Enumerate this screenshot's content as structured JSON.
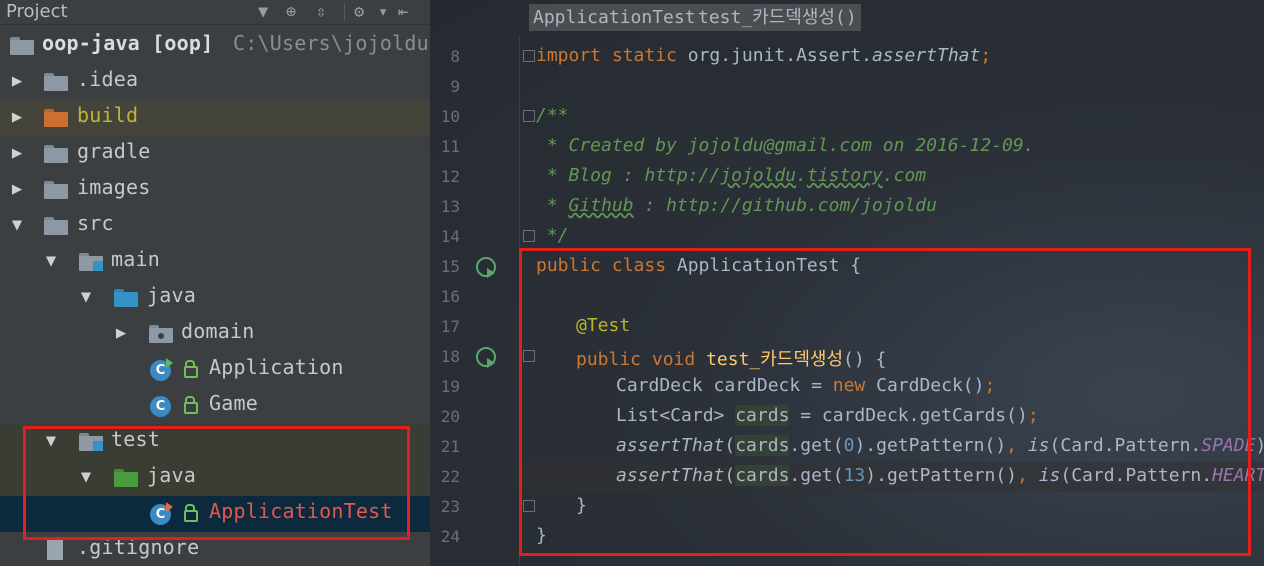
{
  "project_panel": {
    "title": "Project",
    "tree": [
      {
        "id": "root",
        "label": "oop-java [oop]",
        "path": "C:\\Users\\jojoldu\\"
      },
      {
        "id": "idea",
        "label": ".idea"
      },
      {
        "id": "build",
        "label": "build"
      },
      {
        "id": "gradle",
        "label": "gradle"
      },
      {
        "id": "images",
        "label": "images"
      },
      {
        "id": "src",
        "label": "src"
      },
      {
        "id": "main",
        "label": "main"
      },
      {
        "id": "main_java",
        "label": "java"
      },
      {
        "id": "domain",
        "label": "domain"
      },
      {
        "id": "application",
        "label": "Application"
      },
      {
        "id": "game",
        "label": "Game"
      },
      {
        "id": "test",
        "label": "test"
      },
      {
        "id": "test_java",
        "label": "java"
      },
      {
        "id": "application_test",
        "label": "ApplicationTest"
      },
      {
        "id": "gitignore",
        "label": ".gitignore"
      }
    ]
  },
  "editor": {
    "tabs": [
      "ApplicationTest",
      "test_카드덱생성()"
    ],
    "line_numbers": [
      "8",
      "9",
      "10",
      "11",
      "12",
      "13",
      "14",
      "15",
      "16",
      "17",
      "18",
      "19",
      "20",
      "21",
      "22",
      "23",
      "24"
    ],
    "code": {
      "l8_kw": "import static",
      "l8_rest": " org.junit.Assert.",
      "l8_it": "assertThat",
      "l8_semi": ";",
      "l10": "/**",
      "l11": " * Created by jojoldu@gmail.com on 2016-12-09.",
      "l12_a": " * Blog : http://",
      "l12_b": "jojoldu",
      "l12_c": ".",
      "l12_d": "tistory",
      "l12_e": ".com",
      "l13_a": " * ",
      "l13_b": "Github",
      "l13_c": " : http://github.com/jojoldu",
      "l14": " */",
      "l15_kw": "public class",
      "l15_rest": " ApplicationTest {",
      "l17": "@Test",
      "l18_kw": "public void",
      "l18_fn": "test_카드덱생성",
      "l18_rest": "() {",
      "l19_a": "CardDeck cardDeck = ",
      "l19_kw": "new",
      "l19_b": " CardDeck()",
      "l19_semi": ";",
      "l20_a": "List<Card> ",
      "l20_var": "cards",
      "l20_b": " = cardDeck.getCards()",
      "l20_semi": ";",
      "l21_it": "assertThat",
      "l21_a": "(",
      "l21_var": "cards",
      "l21_b": ".get(",
      "l21_num": "0",
      "l21_c": ").getPattern()",
      "l21_comma": ",",
      "l21_is": "is",
      "l21_d": "(Card.Pattern.",
      "l21_fld": "SPADE",
      "l21_e": "))",
      "l21_semi": ";",
      "l22_it": "assertThat",
      "l22_a": "(",
      "l22_var": "cards",
      "l22_b": ".get(",
      "l22_num": "13",
      "l22_c": ").getPattern()",
      "l22_comma": ",",
      "l22_is": "is",
      "l22_d": "(Card.Pattern.",
      "l22_fld": "HEART",
      "l22_e": "))",
      "l22_semi": ";",
      "l23": "}",
      "l24": "}"
    }
  },
  "colors": {
    "keyword": "#cc7832",
    "comment": "#629755",
    "annotation": "#bbb529",
    "method_decl": "#ffc66d",
    "number": "#6897bb",
    "field": "#9876aa",
    "highlight_box": "#e41d1d",
    "selection": "#0d293e"
  },
  "icons": [
    "gear-icon",
    "target-icon",
    "collapse-icon",
    "hide-panel-icon",
    "folder-icon",
    "class-icon",
    "run-icon"
  ]
}
